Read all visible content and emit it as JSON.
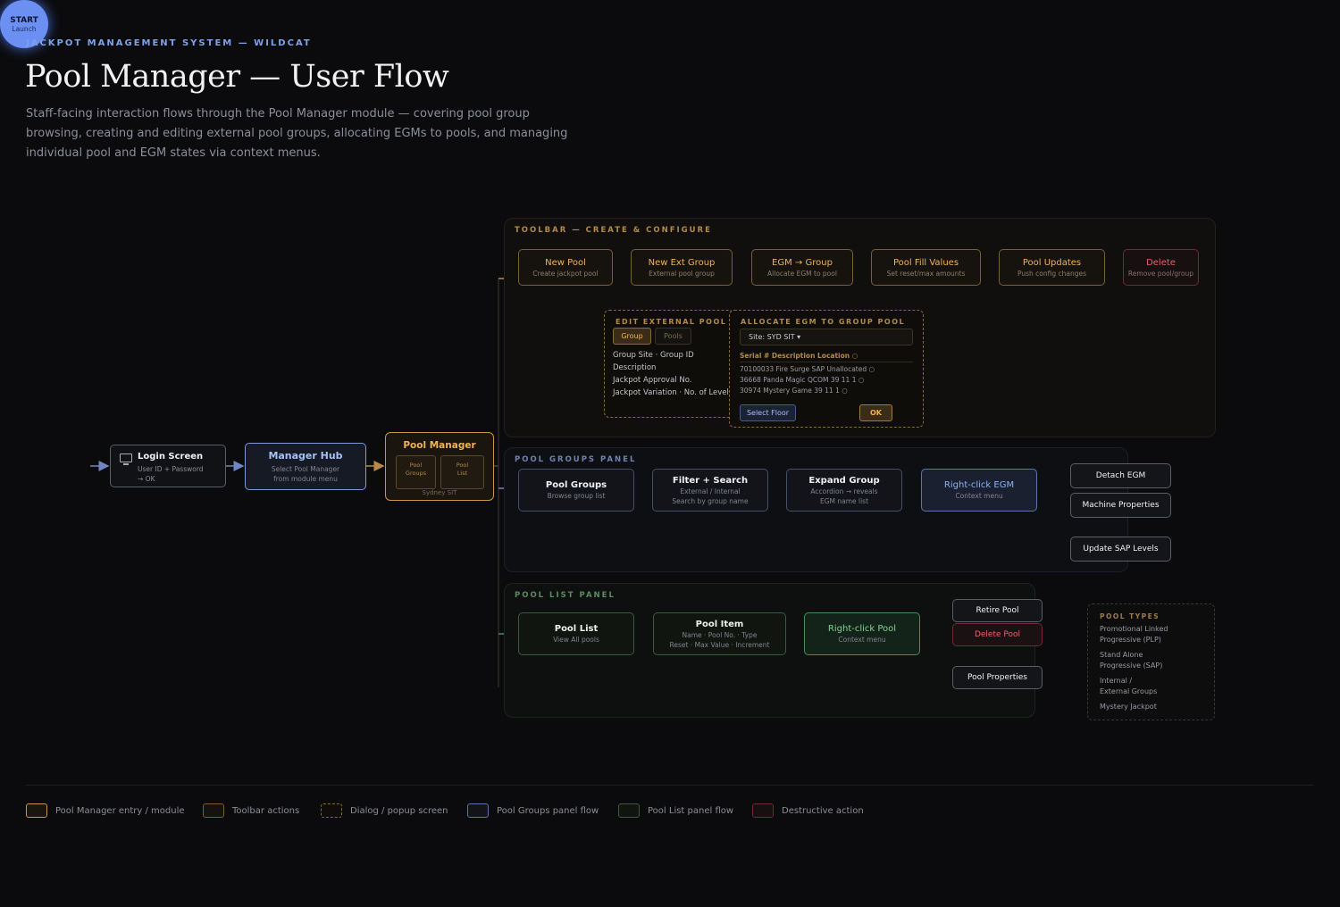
{
  "header": {
    "kicker": "JACKPOT MANAGEMENT SYSTEM — WILDCAT",
    "title": "Pool Manager — User Flow",
    "subtitle": "Staff-facing interaction flows through the Pool Manager module — covering pool group browsing, creating and editing external pool groups, allocating EGMs to pools, and managing individual pool and EGM states via context menus."
  },
  "entry": {
    "start": {
      "title": "START",
      "sub": "Launch"
    },
    "login": {
      "title": "Login Screen",
      "sub1": "User ID + Password",
      "sub2": "→ OK",
      "icon": "monitor-icon"
    },
    "hub": {
      "title": "Manager Hub",
      "sub1": "Select Pool Manager",
      "sub2": "from module menu"
    },
    "pool_manager": {
      "title": "Pool Manager",
      "box1_a": "Pool",
      "box1_b": "Groups",
      "box2_a": "Pool",
      "box2_b": "List",
      "footer": "Sydney SIT"
    }
  },
  "toolbar": {
    "label": "TOOLBAR — CREATE & CONFIGURE",
    "actions": [
      {
        "title": "New Pool",
        "sub": "Create jackpot pool"
      },
      {
        "title": "New Ext Group",
        "sub": "External pool group"
      },
      {
        "title": "EGM → Group",
        "sub": "Allocate EGM to pool"
      },
      {
        "title": "Pool Fill Values",
        "sub": "Set reset/max amounts"
      },
      {
        "title": "Pool Updates",
        "sub": "Push config changes"
      },
      {
        "title": "Delete",
        "sub": "Remove pool/group"
      }
    ]
  },
  "dialog_ext_group": {
    "title": "EDIT EXTERNAL POOL GROUP",
    "tab_active": "Group",
    "tab_inactive": "Pools",
    "fields": [
      "Group Site · Group ID",
      "Description",
      "Jackpot Approval No.",
      "Jackpot Variation · No. of Levels"
    ]
  },
  "dialog_allocate": {
    "title": "ALLOCATE EGM TO GROUP POOL",
    "site_select": "Site: SYD SIT ▾",
    "header": "Serial # Description Location ○",
    "rows": [
      "70100033 Fire Surge SAP Unallocated ○",
      "36668 Panda Magic QCOM 39 11 1 ○",
      "30974 Mystery Game 39 11 1 ○"
    ],
    "select_floor": "Select Floor",
    "ok": "OK"
  },
  "groups_panel": {
    "label": "POOL GROUPS PANEL",
    "steps": [
      {
        "title": "Pool Groups",
        "sub1": "Browse group list",
        "sub2": ""
      },
      {
        "title": "Filter + Search",
        "sub1": "External / Internal",
        "sub2": "Search by group name"
      },
      {
        "title": "Expand Group",
        "sub1": "Accordion → reveals",
        "sub2": "EGM name list"
      },
      {
        "title": "Right-click EGM",
        "sub1": "Context menu",
        "sub2": ""
      }
    ],
    "menu": [
      "Detach EGM",
      "Machine Properties",
      "Update SAP Levels"
    ]
  },
  "list_panel": {
    "label": "POOL LIST PANEL",
    "steps": [
      {
        "title": "Pool List",
        "sub1": "View All pools",
        "sub2": ""
      },
      {
        "title": "Pool Item",
        "sub1": "Name · Pool No. · Type",
        "sub2": "Reset · Max Value · Increment"
      },
      {
        "title": "Right-click Pool",
        "sub1": "Context menu",
        "sub2": ""
      }
    ],
    "menu": [
      "Retire Pool",
      "Delete Pool",
      "Pool Properties"
    ]
  },
  "pool_types": {
    "title": "POOL TYPES",
    "items": [
      {
        "l1": "Promotional Linked",
        "l2": "Progressive (PLP)"
      },
      {
        "l1": "Stand Alone",
        "l2": "Progressive (SAP)"
      },
      {
        "l1": "Internal /",
        "l2": "External Groups"
      },
      {
        "l1": "Mystery Jackpot",
        "l2": ""
      }
    ]
  },
  "legend": [
    {
      "label": "Pool Manager entry / module",
      "color": "#c8954a",
      "style": "solid"
    },
    {
      "label": "Toolbar actions",
      "color": "#7a5f34",
      "style": "solid"
    },
    {
      "label": "Dialog / popup screen",
      "color": "#8a6a34",
      "style": "dashed"
    },
    {
      "label": "Pool Groups panel flow",
      "color": "#5e74a8",
      "style": "solid"
    },
    {
      "label": "Pool List panel flow",
      "color": "#3d5a41",
      "style": "solid"
    },
    {
      "label": "Destructive action",
      "color": "#6e2b30",
      "style": "solid"
    }
  ],
  "colors": {
    "accent_blue": "#7fa2e6",
    "accent_orange": "#f0b35a",
    "accent_green": "#7fd38f",
    "danger": "#e7646b"
  }
}
